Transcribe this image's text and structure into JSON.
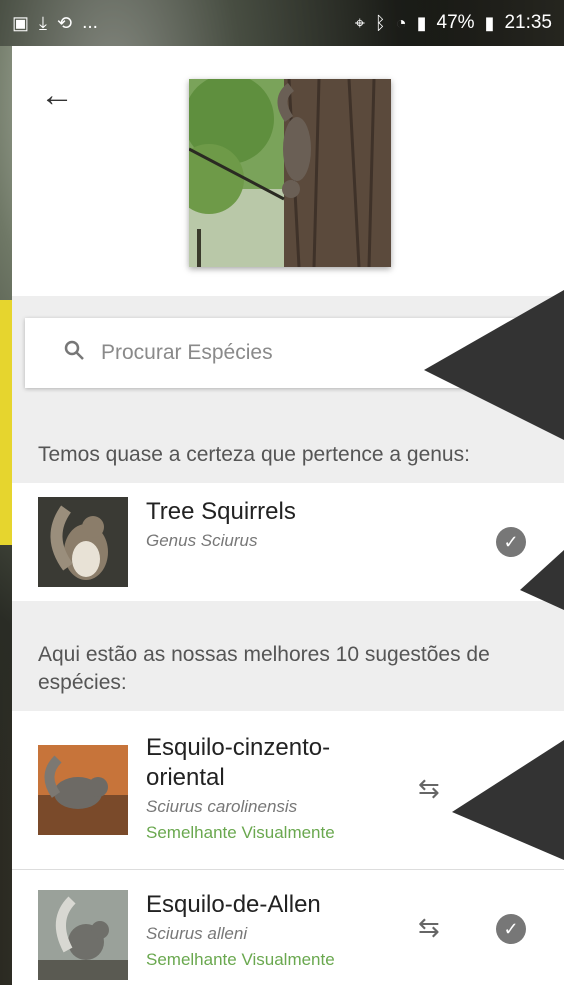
{
  "status_bar": {
    "left_icons": [
      "image-icon",
      "download-icon",
      "sync-icon"
    ],
    "ellipsis": "...",
    "battery": "47%",
    "time": "21:35"
  },
  "header": {
    "back_label": "←"
  },
  "search": {
    "placeholder": "Procurar Espécies"
  },
  "genus_section": {
    "heading": "Temos quase a certeza que pertence a genus:",
    "item": {
      "name": "Tree Squirrels",
      "scientific": "Genus Sciurus"
    }
  },
  "suggestions_section": {
    "heading": "Aqui estão as nossas melhores 10 sugestões de espécies:",
    "items": [
      {
        "name": "Esquilo-cinzento-oriental",
        "scientific": "Sciurus carolinensis",
        "tag": "Semelhante Visualmente"
      },
      {
        "name": "Esquilo-de-Allen",
        "scientific": "Sciurus alleni",
        "tag": "Semelhante Visualmente"
      }
    ]
  },
  "colors": {
    "accent_green": "#6aa84f",
    "section_bg": "#eeeeee"
  }
}
